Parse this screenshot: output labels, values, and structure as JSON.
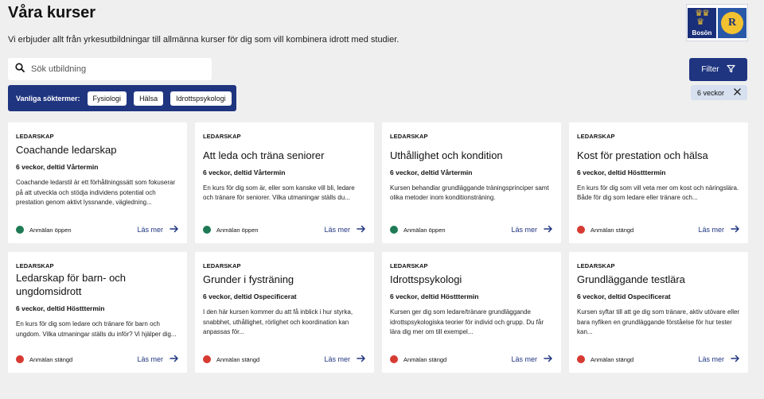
{
  "header": {
    "title": "Våra kurser",
    "intro": "Vi erbjuder allt från yrkesutbildningar till allmänna kurser för dig som vill kombinera idrott med studier."
  },
  "logo": {
    "text": "Bosön",
    "seal_letter": "R"
  },
  "search": {
    "placeholder": "Sök utbildning",
    "value": ""
  },
  "common_terms": {
    "label": "Vanliga söktermer:",
    "items": [
      "Fysiologi",
      "Hälsa",
      "Idrottspsykologi"
    ]
  },
  "filter": {
    "label": "Filter",
    "active_chip": "6 veckor"
  },
  "colors": {
    "navy": "#1f3580",
    "status_open": "#1e7a54",
    "status_closed": "#d63b32"
  },
  "read_more_label": "Läs mer",
  "courses": [
    {
      "category": "LEDARSKAP",
      "title": "Coachande ledarskap",
      "meta": "6 veckor, deltid Vårtermin",
      "desc": "Coachande ledarstil är ett förhållningssätt som fokuserar på att utveckla och stödja individens potential och prestation genom aktivt lyssnande, vägledning...",
      "status": "Anmälan öppen",
      "status_type": "open"
    },
    {
      "category": "LEDARSKAP",
      "title": "Att leda och träna seniorer",
      "meta": "6 veckor, deltid Vårtermin",
      "desc": "En kurs för dig som är, eller som kanske vill bli, ledare och tränare för seniorer. Vilka utmaningar ställs du...",
      "status": "Anmälan öppen",
      "status_type": "open"
    },
    {
      "category": "LEDARSKAP",
      "title": "Uthållighet och kondition",
      "meta": "6 veckor, deltid Vårtermin",
      "desc": "Kursen behandlar grundläggande träningsprinciper samt olika metoder inom konditionsträning.",
      "status": "Anmälan öppen",
      "status_type": "open"
    },
    {
      "category": "LEDARSKAP",
      "title": "Kost för prestation och hälsa",
      "meta": "6 veckor, deltid Höstttermin",
      "desc": "En kurs för dig som vill veta mer om kost och näringslära. Både för dig som ledare eller tränare och...",
      "status": "Anmälan stängd",
      "status_type": "closed"
    },
    {
      "category": "LEDARSKAP",
      "title": "Ledarskap för barn- och ungdomsidrott",
      "meta": "6 veckor, deltid Höstttermin",
      "desc": "En kurs för dig som ledare och tränare för barn och ungdom. Vilka utmaningar ställs du inför? Vi hjälper dig...",
      "status": "Anmälan stängd",
      "status_type": "closed"
    },
    {
      "category": "LEDARSKAP",
      "title": "Grunder i fysträning",
      "meta": "6 veckor, deltid Ospecificerat",
      "desc": "I den här kursen kommer du att få inblick i hur styrka, snabbhet, uthållighet, rörlighet och koordination kan anpassas för...",
      "status": "Anmälan stängd",
      "status_type": "closed"
    },
    {
      "category": "LEDARSKAP",
      "title": "Idrottspsykologi",
      "meta": "6 veckor, deltid Höstttermin",
      "desc": "Kursen ger dig som ledare/tränare grundläggande idrottspsykologiska teorier för individ och grupp. Du får lära dig mer om till exempel...",
      "status": "Anmälan stängd",
      "status_type": "closed"
    },
    {
      "category": "LEDARSKAP",
      "title": "Grundläggande testlära",
      "meta": "6 veckor, deltid Ospecificerat",
      "desc": "Kursen syftar till att ge dig som tränare, aktiv utövare eller bara nyfiken en grundläggande förståelse för hur tester kan...",
      "status": "Anmälan stängd",
      "status_type": "closed"
    }
  ]
}
